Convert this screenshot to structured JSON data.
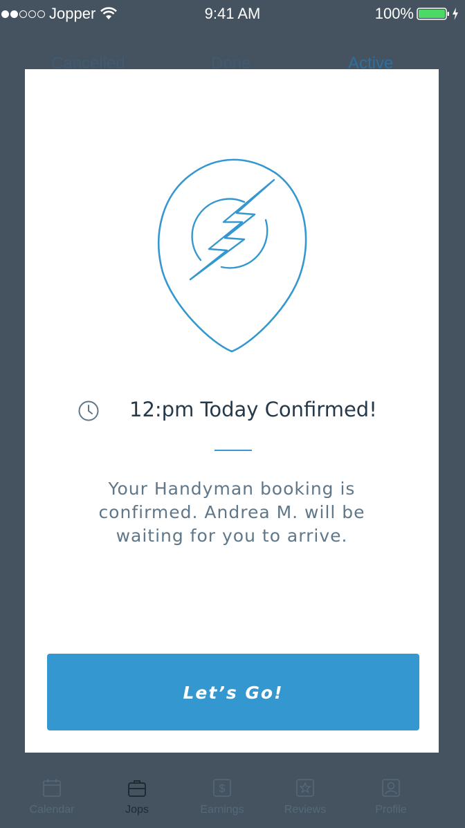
{
  "status_bar": {
    "carrier": "Jopper",
    "time": "9:41 AM",
    "battery": "100%"
  },
  "tabs_segment": {
    "items": [
      "Cancelled",
      "Done",
      "Active"
    ],
    "selected": "Active"
  },
  "bottom_nav": {
    "items": [
      {
        "label": "Calendar",
        "icon": "calendar-icon"
      },
      {
        "label": "Jops",
        "icon": "briefcase-icon"
      },
      {
        "label": "Earnings",
        "icon": "dollar-icon"
      },
      {
        "label": "Reviews",
        "icon": "star-icon"
      },
      {
        "label": "Profile",
        "icon": "profile-icon"
      }
    ],
    "selected": "Jops"
  },
  "modal": {
    "icon": "location-bolt-icon",
    "title": "12:pm Today Confirmed!",
    "message": "Your Handyman booking is confirmed. Andrea M. will be waiting for you to arrive.",
    "button_label": "Let’s Go!"
  },
  "colors": {
    "accent": "#3597cf",
    "overlay": "#44535f",
    "title_text": "#25394a",
    "body_text": "#5f7789"
  }
}
